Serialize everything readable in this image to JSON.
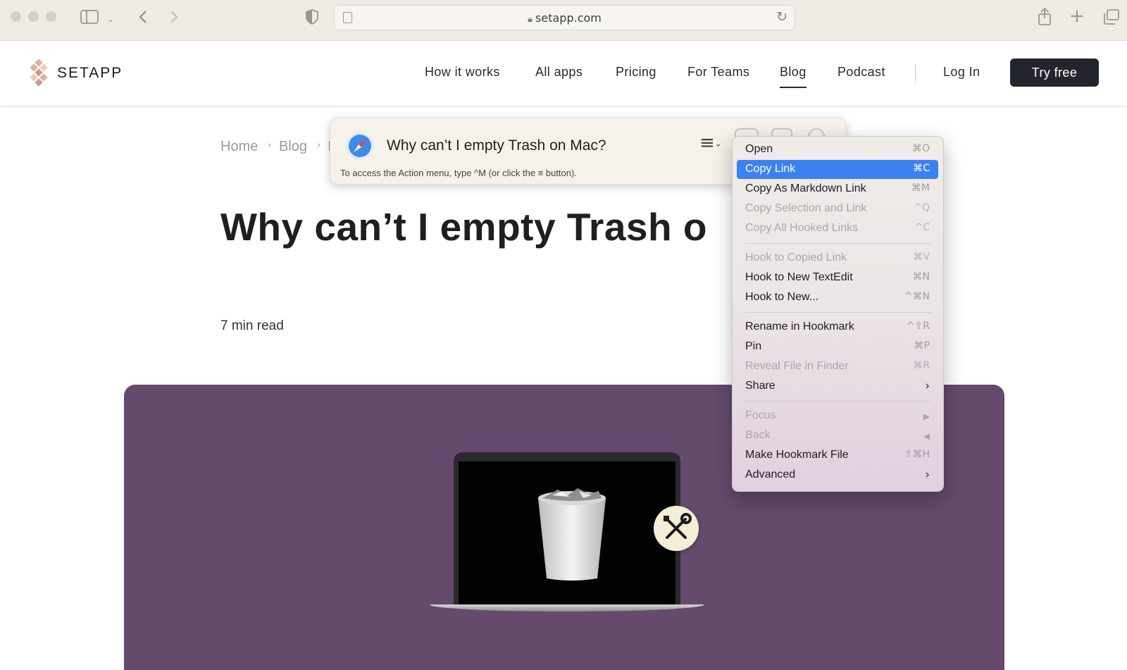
{
  "browser": {
    "url": "setapp.com"
  },
  "site": {
    "brand": "SETAPP",
    "nav": [
      "How it works",
      "All apps",
      "Pricing",
      "For Teams",
      "Blog",
      "Podcast"
    ],
    "login": "Log In",
    "cta": "Try free"
  },
  "page": {
    "breadcrumb": [
      "Home",
      "Blog",
      "I"
    ],
    "title": "Why can’t I empty Trash o",
    "read_time": "7 min read"
  },
  "hookmark": {
    "title": "Why can’t I empty Trash on Mac?",
    "hint": "To access the Action menu, type ^M (or click the ≡ button)."
  },
  "menu": {
    "items": [
      {
        "label": "Open",
        "shortcut": "⌘O",
        "disabled": false
      },
      {
        "label": "Copy Link",
        "shortcut": "⌘C",
        "disabled": false,
        "selected": true
      },
      {
        "label": "Copy As Markdown Link",
        "shortcut": "⌘M",
        "disabled": false
      },
      {
        "label": "Copy Selection and Link",
        "shortcut": "^Q",
        "disabled": true
      },
      {
        "label": "Copy All Hooked Links",
        "shortcut": "^C",
        "disabled": true
      },
      {
        "label": "Hook to Copied Link",
        "shortcut": "⌘V",
        "disabled": true
      },
      {
        "label": "Hook to New TextEdit",
        "shortcut": "⌘N",
        "disabled": false
      },
      {
        "label": "Hook to New...",
        "shortcut": "^⌘N",
        "disabled": false
      },
      {
        "label": "Rename in Hookmark",
        "shortcut": "^⇧R",
        "disabled": false
      },
      {
        "label": "Pin",
        "shortcut": "⌘P",
        "disabled": false
      },
      {
        "label": "Reveal File in Finder",
        "shortcut": "⌘R",
        "disabled": true
      },
      {
        "label": "Share",
        "shortcut": "›",
        "disabled": false
      },
      {
        "label": "Focus",
        "shortcut": "▶",
        "disabled": true
      },
      {
        "label": "Back",
        "shortcut": "◀",
        "disabled": true
      },
      {
        "label": "Make Hookmark File",
        "shortcut": "⇧⌘H",
        "disabled": false
      },
      {
        "label": "Advanced",
        "shortcut": "›",
        "disabled": false
      }
    ]
  },
  "colors": {
    "hero_bg": "#644a6c",
    "selection": "#3b82f0",
    "cta_bg": "#23252c",
    "brand_mark": "#d9b39a"
  },
  "icons": {
    "browser": [
      "sidebar-icon",
      "chevron-down-icon",
      "back-icon",
      "forward-icon",
      "shield-icon",
      "reader-icon",
      "lock-icon",
      "reload-icon",
      "share-icon",
      "plus-icon",
      "tabs-icon"
    ],
    "hookmark": [
      "safari-compass-icon",
      "action-menu-icon"
    ],
    "hero": [
      "trash-bin-icon",
      "wrench-screwdriver-icon"
    ]
  }
}
